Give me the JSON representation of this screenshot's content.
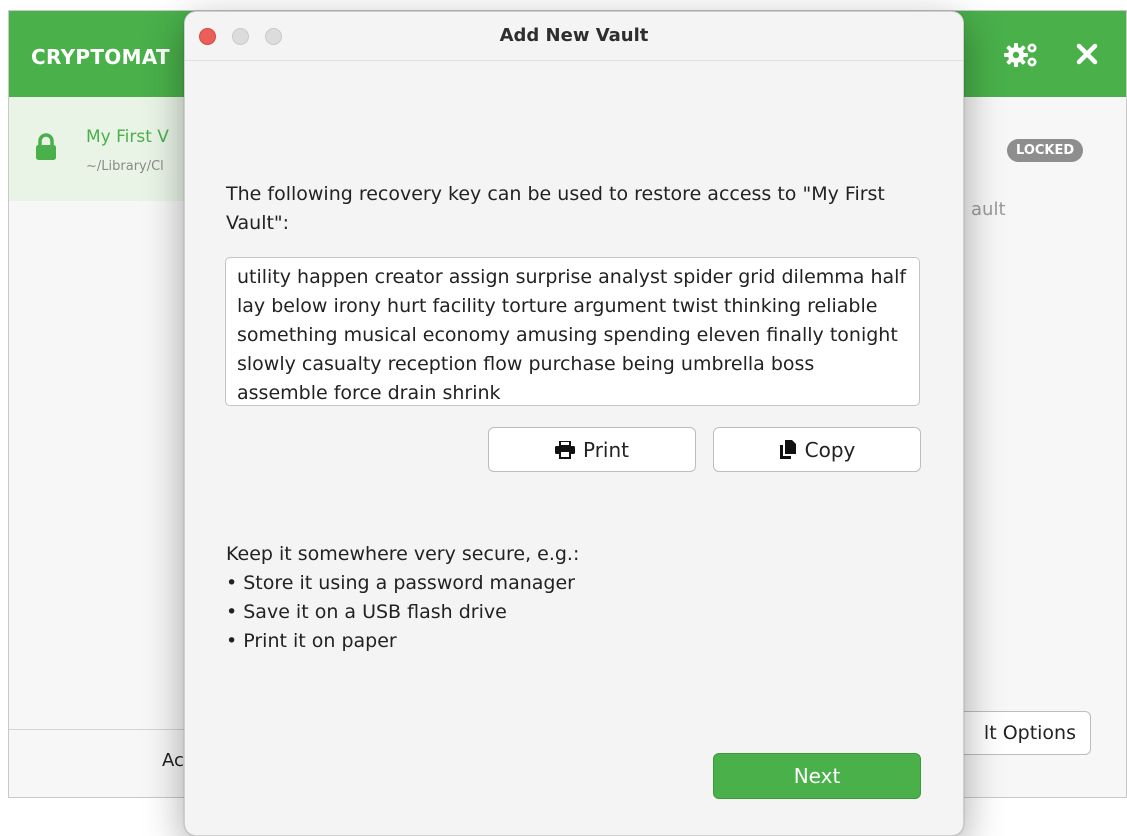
{
  "main_window": {
    "brand": "CRYPTOMAT",
    "vault": {
      "name": "My First V",
      "path": "~/Library/Cl"
    },
    "add_vault_fragment": "Ac",
    "status_badge": "LOCKED",
    "detail_fragment": "ault",
    "vault_options_fragment": "lt Options"
  },
  "dialog": {
    "title": "Add New Vault",
    "intro": "The following recovery key can be used to restore access to \"My First Vault\":",
    "recovery_key": "utility happen creator assign surprise analyst spider grid dilemma half lay below irony hurt facility torture argument twist thinking reliable something musical economy amusing spending eleven finally tonight slowly casualty reception flow purchase being umbrella boss assemble force drain shrink",
    "print_label": "Print",
    "copy_label": "Copy",
    "secure_heading": "Keep it somewhere very secure, e.g.:",
    "secure_items": [
      "• Store it using a password manager",
      "• Save it on a USB flash drive",
      "• Print it on paper"
    ],
    "next_label": "Next"
  },
  "colors": {
    "accent": "#49b04a",
    "badge": "#8e8e8e",
    "close_traffic": "#ec5f58"
  },
  "icons": [
    "gear-icon",
    "close-icon",
    "lock-icon",
    "printer-icon",
    "copy-icon"
  ]
}
